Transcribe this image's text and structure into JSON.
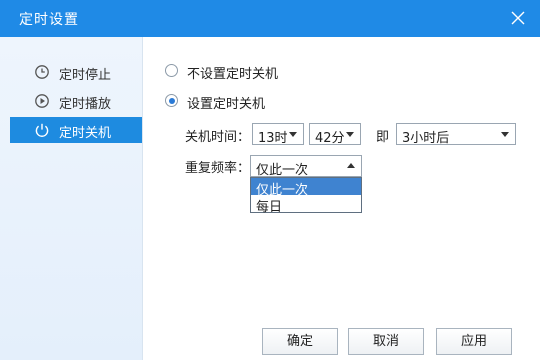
{
  "window": {
    "title": "定时设置",
    "colors": {
      "titlebar": "#1f8ae6",
      "sidebar_active": "#1e8be0",
      "selected_option": "#3f83d0"
    }
  },
  "sidebar": {
    "items": [
      {
        "label": "定时停止",
        "icon": "timer-stop-icon",
        "active": false
      },
      {
        "label": "定时播放",
        "icon": "timer-play-icon",
        "active": false
      },
      {
        "label": "定时关机",
        "icon": "power-icon",
        "active": true
      }
    ]
  },
  "options": {
    "no_shutdown_label": "不设置定时关机",
    "set_shutdown_label": "设置定时关机",
    "selected": "set_shutdown"
  },
  "shutdown_time": {
    "label": "关机时间：",
    "hour": "13时",
    "minute": "42分",
    "connector": "即",
    "relative": "3小时后"
  },
  "repeat": {
    "label": "重复频率：",
    "value": "仅此一次",
    "dropdown_open": true,
    "options": [
      "仅此一次",
      "每日"
    ]
  },
  "buttons": {
    "ok": "确定",
    "cancel": "取消",
    "apply": "应用"
  }
}
